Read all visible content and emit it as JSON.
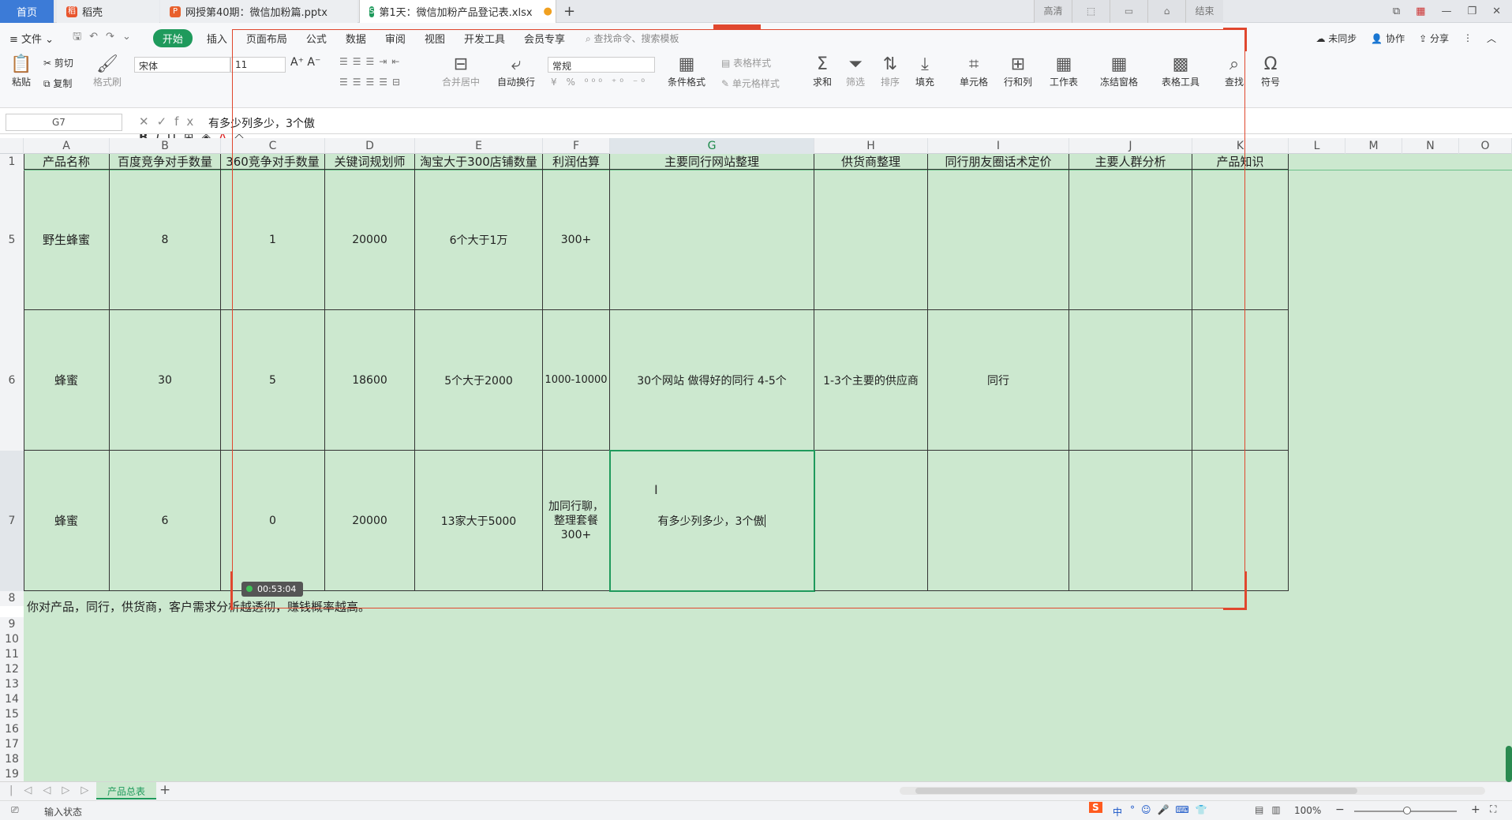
{
  "tabs": {
    "home": "首页",
    "t1": "稻壳",
    "t2": "网授第40期：微信加粉篇.pptx",
    "t3": "第1天：微信加粉产品登记表.xlsx"
  },
  "recorder": {
    "b1": "高清",
    "b4": "结束",
    "timer": "00:53:04"
  },
  "menu": {
    "file": "文件",
    "items": [
      "开始",
      "插入",
      "页面布局",
      "公式",
      "数据",
      "审阅",
      "视图",
      "开发工具",
      "会员专享"
    ],
    "search": "查找命令、搜索模板",
    "right": [
      "未同步",
      "协作",
      "分享"
    ]
  },
  "ribbon": {
    "paste": "粘贴",
    "cut": "剪切",
    "copy": "复制",
    "format_painter": "格式刷",
    "font": "宋体",
    "size": "11",
    "number_format": "常规",
    "merge": "合并居中",
    "wrap": "自动换行",
    "table_style": "表格样式",
    "cond_format": "条件格式",
    "cell_style": "单元格样式",
    "sum": "求和",
    "filter": "筛选",
    "sort": "排序",
    "fill": "填充",
    "cell": "单元格",
    "rowcol": "行和列",
    "sheet": "工作表",
    "freeze": "冻结窗格",
    "tools": "表格工具",
    "find": "查找",
    "symbol": "符号"
  },
  "formula": {
    "namebox": "G7",
    "content": "有多少列多少，3个傲"
  },
  "columns": [
    "A",
    "B",
    "C",
    "D",
    "E",
    "F",
    "G",
    "H",
    "I",
    "J",
    "K",
    "L",
    "M",
    "N",
    "O"
  ],
  "rows": [
    "1",
    "5",
    "6",
    "7",
    "8",
    "9",
    "10",
    "11",
    "12",
    "13",
    "14",
    "15",
    "16",
    "17",
    "18",
    "19"
  ],
  "headers": [
    "产品名称",
    "百度竞争对手数量",
    "360竞争对手数量",
    "关键词规划师",
    "淘宝大于300店铺数量",
    "利润估算",
    "主要同行网站整理",
    "供货商整理",
    "同行朋友圈话术定价",
    "主要人群分析",
    "产品知识"
  ],
  "data_rows": [
    [
      "野生蜂蜜",
      "8",
      "1",
      "20000",
      "6个大于1万",
      "300+",
      "",
      "",
      "",
      "",
      ""
    ],
    [
      "蜂蜜",
      "30",
      "5",
      "18600",
      "5个大于2000",
      "1000-10000",
      "30个网站 做得好的同行 4-5个",
      "1-3个主要的供应商",
      "同行",
      "",
      ""
    ],
    [
      "蜂蜜",
      "6",
      "0",
      "20000",
      "13家大于5000",
      "加同行聊，整理套餐 300+",
      "有多少列多少，3个傲",
      "",
      "",
      "",
      ""
    ]
  ],
  "note_row8": "你对产品，同行，供货商，客户需求分析越透彻，赚钱概率越高。",
  "sheet_tab": "产品总表",
  "status": {
    "input": "输入状态",
    "zoom": "100%",
    "ime": "中"
  }
}
